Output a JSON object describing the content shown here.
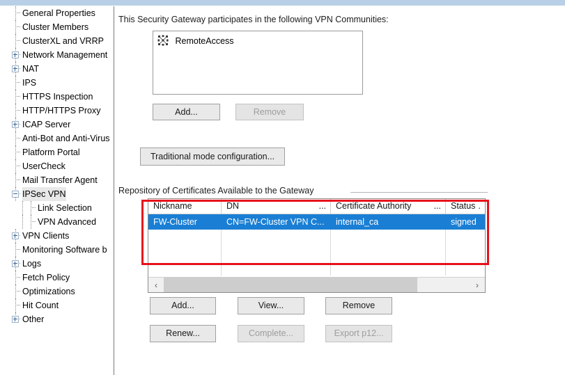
{
  "sidebar": {
    "items": [
      {
        "label": "General Properties",
        "level": 1,
        "expander": "none",
        "selected": false
      },
      {
        "label": "Cluster Members",
        "level": 1,
        "expander": "none",
        "selected": false
      },
      {
        "label": "ClusterXL and VRRP",
        "level": 1,
        "expander": "none",
        "selected": false
      },
      {
        "label": "Network Management",
        "level": 1,
        "expander": "plus",
        "selected": false
      },
      {
        "label": "NAT",
        "level": 1,
        "expander": "plus",
        "selected": false
      },
      {
        "label": "IPS",
        "level": 1,
        "expander": "none",
        "selected": false
      },
      {
        "label": "HTTPS Inspection",
        "level": 1,
        "expander": "none",
        "selected": false
      },
      {
        "label": "HTTP/HTTPS Proxy",
        "level": 1,
        "expander": "none",
        "selected": false
      },
      {
        "label": "ICAP Server",
        "level": 1,
        "expander": "plus",
        "selected": false
      },
      {
        "label": "Anti-Bot and Anti-Virus",
        "level": 1,
        "expander": "none",
        "selected": false
      },
      {
        "label": "Platform Portal",
        "level": 1,
        "expander": "none",
        "selected": false
      },
      {
        "label": "UserCheck",
        "level": 1,
        "expander": "none",
        "selected": false
      },
      {
        "label": "Mail Transfer Agent",
        "level": 1,
        "expander": "none",
        "selected": false
      },
      {
        "label": "IPSec VPN",
        "level": 1,
        "expander": "minus",
        "selected": true
      },
      {
        "label": "Link Selection",
        "level": 2,
        "expander": "none",
        "selected": false
      },
      {
        "label": "VPN Advanced",
        "level": 2,
        "expander": "none",
        "selected": false
      },
      {
        "label": "VPN Clients",
        "level": 1,
        "expander": "plus",
        "selected": false
      },
      {
        "label": "Monitoring Software b",
        "level": 1,
        "expander": "none",
        "selected": false
      },
      {
        "label": "Logs",
        "level": 1,
        "expander": "plus",
        "selected": false
      },
      {
        "label": "Fetch Policy",
        "level": 1,
        "expander": "none",
        "selected": false
      },
      {
        "label": "Optimizations",
        "level": 1,
        "expander": "none",
        "selected": false
      },
      {
        "label": "Hit Count",
        "level": 1,
        "expander": "none",
        "selected": false
      },
      {
        "label": "Other",
        "level": 1,
        "expander": "plus",
        "selected": false
      }
    ]
  },
  "main": {
    "communities_label": "This Security Gateway participates in the following VPN Communities:",
    "communities": [
      {
        "name": "RemoteAccess",
        "icon": "vpn-community-star-icon"
      }
    ],
    "community_buttons": {
      "add": "Add...",
      "remove": "Remove"
    },
    "traditional_button": "Traditional mode configuration...",
    "repository_label": "Repository of Certificates Available to the Gateway",
    "table": {
      "columns": [
        {
          "label": "Nickname",
          "overflow": ""
        },
        {
          "label": "DN",
          "overflow": "..."
        },
        {
          "label": "Certificate Authority",
          "overflow": "..."
        },
        {
          "label": "Status",
          "overflow": "."
        }
      ],
      "rows": [
        {
          "nickname": "FW-Cluster",
          "dn": "CN=FW-Cluster VPN C...",
          "certificate_authority": "internal_ca",
          "status": "signed",
          "selected": true
        }
      ],
      "empty_rows": 2,
      "scrollbar": {
        "left_arrow": "‹",
        "right_arrow": "›",
        "thumb_percent": 83
      }
    },
    "cert_buttons": {
      "add": "Add...",
      "view": "View...",
      "remove": "Remove",
      "renew": "Renew...",
      "complete": "Complete...",
      "export": "Export p12..."
    }
  },
  "colors": {
    "selection_blue": "#1a7fd4",
    "annotation_red": "#e8111a",
    "top_strip_blue": "#b9cfe7",
    "button_face": "#e9e9e9",
    "disabled_text": "#9d9d9d"
  }
}
